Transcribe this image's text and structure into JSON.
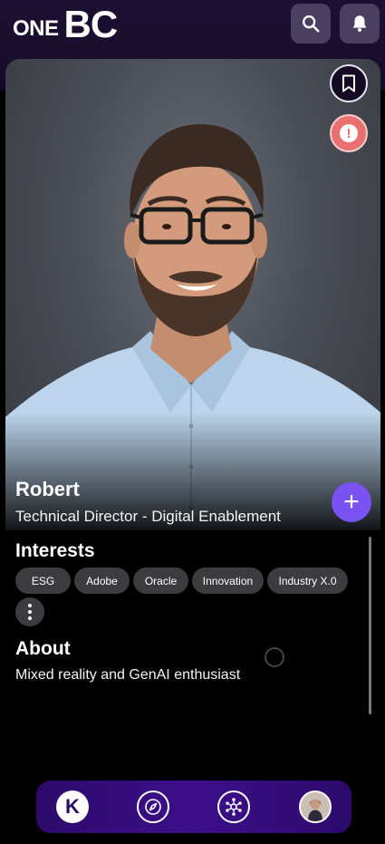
{
  "header": {
    "logo_one": "ONE",
    "logo_bc": "BC",
    "search_icon": "search-icon",
    "bell_icon": "bell-icon"
  },
  "profile": {
    "name": "Robert",
    "title": "Technical Director - Digital Enablement",
    "photo_subject": "smiling man with glasses and beard in light blue shirt"
  },
  "actions": {
    "bookmark_icon": "bookmark-icon",
    "alert_icon": "exclamation-icon",
    "alert_glyph": "!",
    "add_glyph": "+"
  },
  "interests": {
    "heading": "Interests",
    "items": [
      "ESG",
      "Adobe",
      "Oracle",
      "Innovation",
      "Industry X.0"
    ]
  },
  "about": {
    "heading": "About",
    "text": "Mixed reality and GenAI enthusiast"
  },
  "bottom_nav": {
    "k_label": "K",
    "icons": [
      "k-logo-icon",
      "compass-icon",
      "network-icon",
      "avatar"
    ]
  },
  "colors": {
    "header_bg": "#1c0f33",
    "accent_purple": "#7a52f2",
    "alert_red": "#ea6f6f",
    "nav_bg": "#3d0f8a",
    "chip_bg": "#3c3c3f"
  }
}
